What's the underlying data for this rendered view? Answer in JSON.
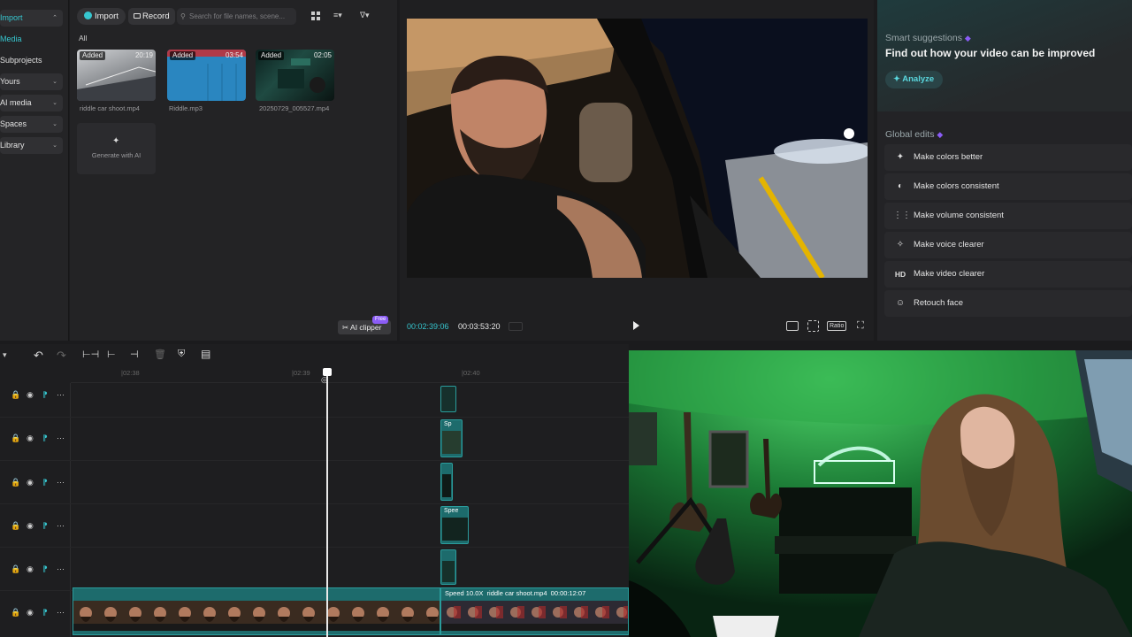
{
  "nav": {
    "items": [
      {
        "label": "Import",
        "expandable": true,
        "active": true
      },
      {
        "label": "Media",
        "expandable": false,
        "active": true
      },
      {
        "label": "Subprojects",
        "expandable": false,
        "active": false
      },
      {
        "label": "Yours",
        "expandable": true,
        "active": false
      },
      {
        "label": "AI media",
        "expandable": true,
        "active": false
      },
      {
        "label": "Spaces",
        "expandable": true,
        "active": false
      },
      {
        "label": "Library",
        "expandable": true,
        "active": false
      }
    ]
  },
  "media": {
    "import_label": "Import",
    "record_label": "Record",
    "search_placeholder": "Search for file names, scene...",
    "filter_label": "All",
    "items": [
      {
        "badge": "Added",
        "duration": "20:19",
        "name": "riddle car shoot.mp4"
      },
      {
        "badge": "Added",
        "duration": "03:54",
        "name": "Riddle.mp3"
      },
      {
        "badge": "Added",
        "duration": "02:05",
        "name": "20250729_005527.mp4"
      }
    ],
    "generate_label": "Generate with AI",
    "ai_clipper_label": "AI clipper",
    "ai_clipper_badge": "Free"
  },
  "player": {
    "current_time": "00:02:39:06",
    "total_time": "00:03:53:20",
    "ratio_label": "Ratio"
  },
  "suggestions": {
    "heading": "Smart suggestions",
    "title": "Find out how your video can be improved",
    "analyze_label": "Analyze",
    "global_heading": "Global edits",
    "edits": [
      {
        "label": "Make colors better",
        "icon": "magic-wand-icon"
      },
      {
        "label": "Make colors consistent",
        "icon": "color-match-icon"
      },
      {
        "label": "Make volume consistent",
        "icon": "volume-sliders-icon"
      },
      {
        "label": "Make voice clearer",
        "icon": "voice-sparkle-icon"
      },
      {
        "label": "Make video clearer",
        "icon": "hd-icon"
      },
      {
        "label": "Retouch face",
        "icon": "face-icon"
      }
    ]
  },
  "timeline": {
    "ruler": [
      "|02:38",
      "|02:39",
      "|02:40"
    ],
    "clip_labels": [
      "Sp",
      "Spee",
      "Speed 10.0X  riddle car shoot.mp4  00:00:12:07"
    ]
  },
  "colors": {
    "accent": "#36c6cf",
    "clip": "#1d6b6c",
    "purple": "#8b5cf6"
  }
}
